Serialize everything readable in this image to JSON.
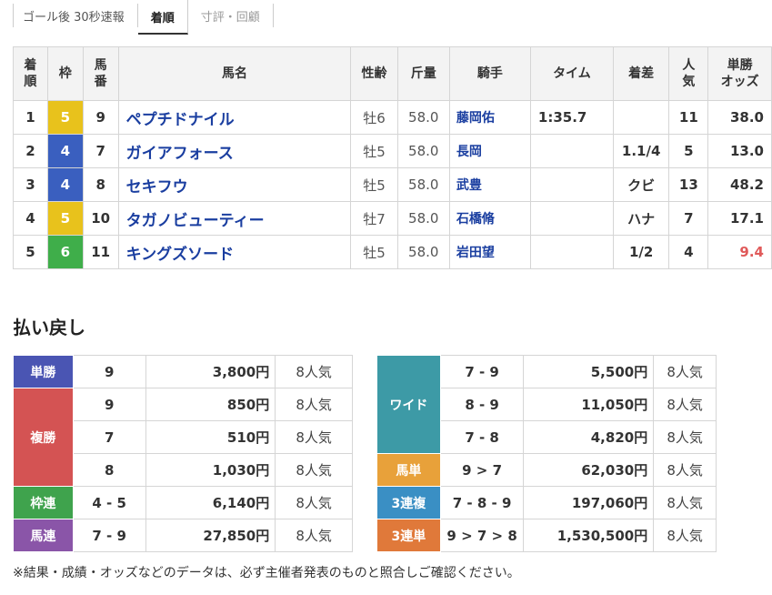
{
  "tabs": [
    {
      "label": "ゴール後 30秒速報"
    },
    {
      "label": "着順"
    },
    {
      "label": "寸評・回顧"
    }
  ],
  "results": {
    "headers": {
      "rank": "着\n順",
      "waku": "枠",
      "num": "馬\n番",
      "name": "馬名",
      "sexage": "性齢",
      "weight": "斤量",
      "jockey": "騎手",
      "time": "タイム",
      "margin": "着差",
      "pop": "人\n気",
      "odds": "単勝\nオッズ"
    },
    "rows": [
      {
        "rank": "1",
        "waku": "5",
        "waku_color": "#e8c21c",
        "num": "9",
        "name": "ペプチドナイル",
        "sexage": "牡6",
        "weight": "58.0",
        "jockey": "藤岡佑",
        "time": "1:35.7",
        "margin": "",
        "pop": "11",
        "odds": "38.0",
        "odds_low": false
      },
      {
        "rank": "2",
        "waku": "4",
        "waku_color": "#3a5fbf",
        "num": "7",
        "name": "ガイアフォース",
        "sexage": "牡5",
        "weight": "58.0",
        "jockey": "長岡",
        "time": "",
        "margin": "1.1/4",
        "pop": "5",
        "odds": "13.0",
        "odds_low": false
      },
      {
        "rank": "3",
        "waku": "4",
        "waku_color": "#3a5fbf",
        "num": "8",
        "name": "セキフウ",
        "sexage": "牡5",
        "weight": "58.0",
        "jockey": "武豊",
        "time": "",
        "margin": "クビ",
        "pop": "13",
        "odds": "48.2",
        "odds_low": false
      },
      {
        "rank": "4",
        "waku": "5",
        "waku_color": "#e8c21c",
        "num": "10",
        "name": "タガノビューティー",
        "sexage": "牡7",
        "weight": "58.0",
        "jockey": "石橋脩",
        "time": "",
        "margin": "ハナ",
        "pop": "7",
        "odds": "17.1",
        "odds_low": false
      },
      {
        "rank": "5",
        "waku": "6",
        "waku_color": "#3fae4a",
        "num": "11",
        "name": "キングズソード",
        "sexage": "牡5",
        "weight": "58.0",
        "jockey": "岩田望",
        "time": "",
        "margin": "1/2",
        "pop": "4",
        "odds": "9.4",
        "odds_low": true
      }
    ]
  },
  "payout": {
    "title": "払い戻し",
    "left": [
      {
        "label": "単勝",
        "color": "#4a55b3",
        "rows": [
          {
            "combo": "9",
            "yen": "3,800円",
            "pop": "8人気"
          }
        ]
      },
      {
        "label": "複勝",
        "color": "#d45353",
        "rows": [
          {
            "combo": "9",
            "yen": "850円",
            "pop": "8人気"
          },
          {
            "combo": "7",
            "yen": "510円",
            "pop": "8人気"
          },
          {
            "combo": "8",
            "yen": "1,030円",
            "pop": "8人気"
          }
        ]
      },
      {
        "label": "枠連",
        "color": "#3fa34d",
        "rows": [
          {
            "combo": "4 - 5",
            "yen": "6,140円",
            "pop": "8人気"
          }
        ]
      },
      {
        "label": "馬連",
        "color": "#8a55a8",
        "rows": [
          {
            "combo": "7 - 9",
            "yen": "27,850円",
            "pop": "8人気"
          }
        ]
      }
    ],
    "right": [
      {
        "label": "ワイド",
        "color": "#3d9aa6",
        "rows": [
          {
            "combo": "7 - 9",
            "yen": "5,500円",
            "pop": "8人気"
          },
          {
            "combo": "8 - 9",
            "yen": "11,050円",
            "pop": "8人気"
          },
          {
            "combo": "7 - 8",
            "yen": "4,820円",
            "pop": "8人気"
          }
        ]
      },
      {
        "label": "馬単",
        "color": "#e8a13a",
        "rows": [
          {
            "combo": "9 > 7",
            "yen": "62,030円",
            "pop": "8人気"
          }
        ]
      },
      {
        "label": "3連複",
        "color": "#3a8fc4",
        "rows": [
          {
            "combo": "7 - 8 - 9",
            "yen": "197,060円",
            "pop": "8人気"
          }
        ]
      },
      {
        "label": "3連単",
        "color": "#e0793a",
        "rows": [
          {
            "combo": "9 > 7 > 8",
            "yen": "1,530,500円",
            "pop": "8人気"
          }
        ]
      }
    ]
  },
  "note": "※結果・成績・オッズなどのデータは、必ず主催者発表のものと照合しご確認ください。"
}
